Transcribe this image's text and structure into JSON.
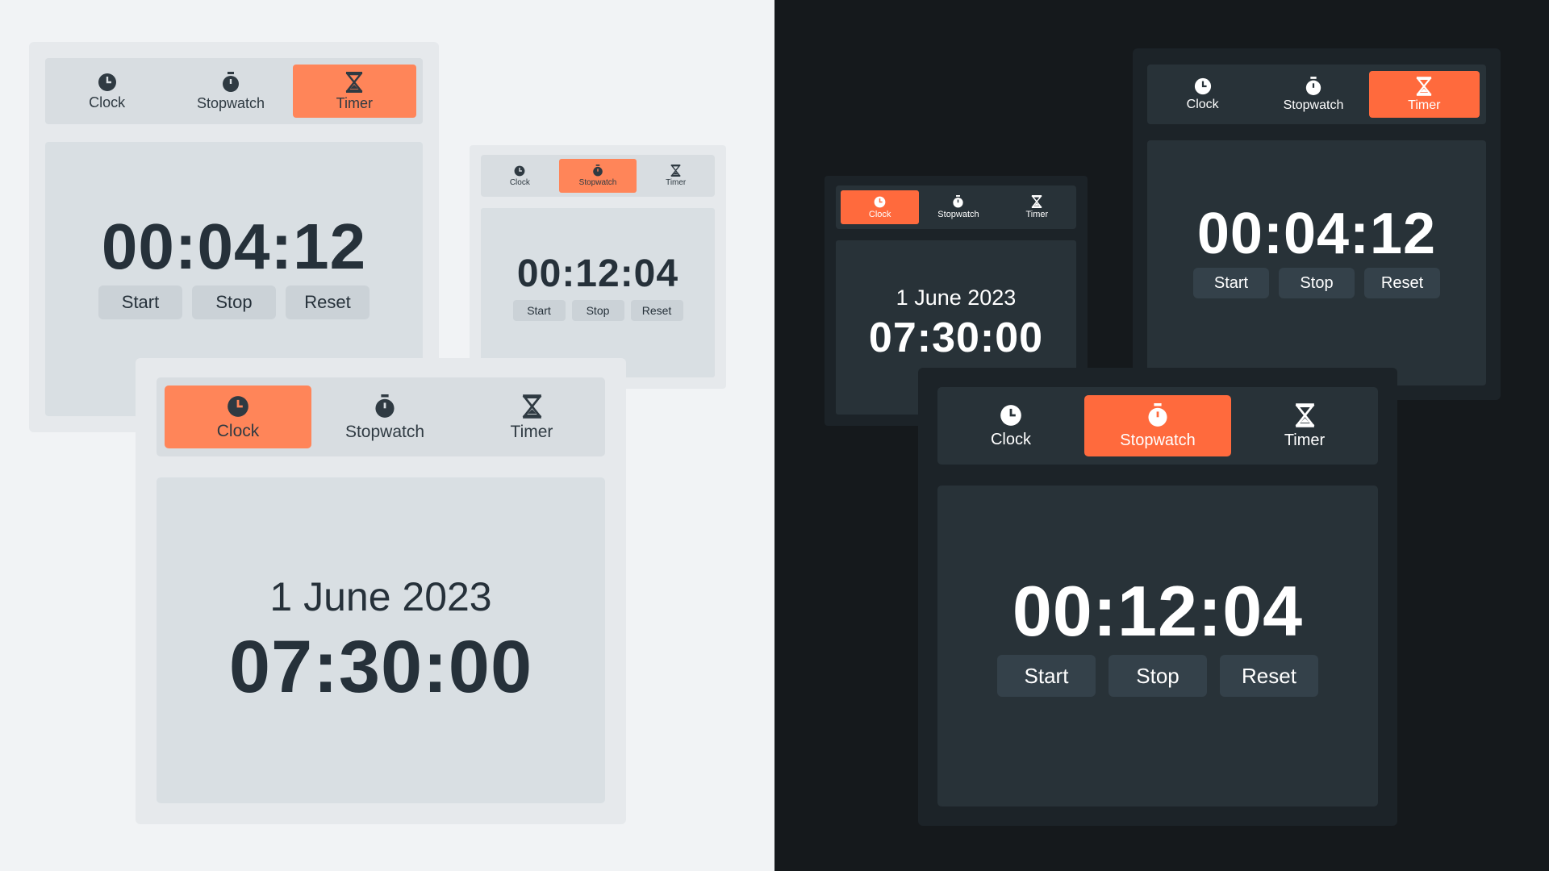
{
  "tabs": {
    "clock": "Clock",
    "stopwatch": "Stopwatch",
    "timer": "Timer"
  },
  "icons": {
    "clock": "clock-icon",
    "stopwatch": "stopwatch-icon",
    "timer": "hourglass-icon"
  },
  "buttons": {
    "start": "Start",
    "stop": "Stop",
    "reset": "Reset"
  },
  "timer_view": {
    "time": "00:04:12"
  },
  "stopwatch_view": {
    "time": "00:12:04"
  },
  "clock_view": {
    "date": "1 June 2023",
    "time": "07:30:00"
  },
  "colors": {
    "accent": "#ff6a3d",
    "light_background": "#f1f3f5",
    "dark_background": "#15191c"
  }
}
